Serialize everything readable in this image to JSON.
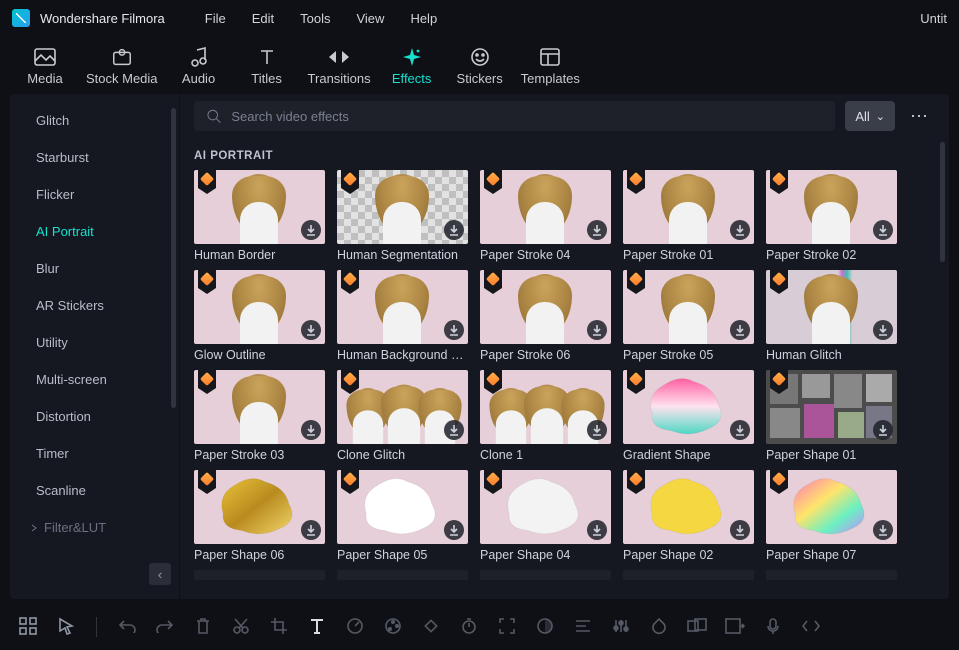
{
  "app": {
    "title": "Wondershare Filmora",
    "documentTitle": "Untit"
  },
  "menu": [
    "File",
    "Edit",
    "Tools",
    "View",
    "Help"
  ],
  "tool_tabs": [
    {
      "id": "media",
      "label": "Media",
      "icon": "image-icon"
    },
    {
      "id": "stockmedia",
      "label": "Stock Media",
      "icon": "cloud-image-icon"
    },
    {
      "id": "audio",
      "label": "Audio",
      "icon": "music-note-icon"
    },
    {
      "id": "titles",
      "label": "Titles",
      "icon": "text-icon"
    },
    {
      "id": "transitions",
      "label": "Transitions",
      "icon": "transition-icon"
    },
    {
      "id": "effects",
      "label": "Effects",
      "icon": "sparkle-icon",
      "active": true
    },
    {
      "id": "stickers",
      "label": "Stickers",
      "icon": "sticker-icon"
    },
    {
      "id": "templates",
      "label": "Templates",
      "icon": "template-icon"
    }
  ],
  "sidebar": {
    "items": [
      {
        "label": "Glitch"
      },
      {
        "label": "Starburst"
      },
      {
        "label": "Flicker"
      },
      {
        "label": "AI Portrait",
        "active": true
      },
      {
        "label": "Blur"
      },
      {
        "label": "AR Stickers"
      },
      {
        "label": "Utility"
      },
      {
        "label": "Multi-screen"
      },
      {
        "label": "Distortion"
      },
      {
        "label": "Timer"
      },
      {
        "label": "Scanline"
      }
    ],
    "footer_item": "Filter&LUT",
    "collapse_glyph": "‹"
  },
  "search": {
    "placeholder": "Search video effects",
    "filter_label": "All",
    "filter_chevron": "⌄"
  },
  "section_title": "AI PORTRAIT",
  "cards": [
    {
      "label": "Human Border",
      "thumbClass": "",
      "person": true
    },
    {
      "label": "Human Segmentation",
      "thumbClass": "checker",
      "person": true
    },
    {
      "label": "Paper Stroke 04",
      "thumbClass": "",
      "person": true
    },
    {
      "label": "Paper Stroke 01",
      "thumbClass": "",
      "person": true
    },
    {
      "label": "Paper Stroke 02",
      "thumbClass": "",
      "person": true
    },
    {
      "label": "Glow Outline",
      "thumbClass": "",
      "person": true
    },
    {
      "label": "Human Background Bl…",
      "thumbClass": "",
      "person": true
    },
    {
      "label": "Paper Stroke 06",
      "thumbClass": "",
      "person": true
    },
    {
      "label": "Paper Stroke 05",
      "thumbClass": "",
      "person": true
    },
    {
      "label": "Human Glitch",
      "thumbClass": "glitch",
      "person": true
    },
    {
      "label": "Paper Stroke 03",
      "thumbClass": "",
      "person": true
    },
    {
      "label": "Clone Glitch",
      "thumbClass": "",
      "person": "triple"
    },
    {
      "label": "Clone 1",
      "thumbClass": "",
      "person": "triple"
    },
    {
      "label": "Gradient Shape",
      "thumbClass": "gradient",
      "shape": "gradient"
    },
    {
      "label": "Paper Shape 01",
      "thumbClass": "collage",
      "shape": "none"
    },
    {
      "label": "Paper Shape 06",
      "thumbClass": "",
      "shape": "gold"
    },
    {
      "label": "Paper Shape 05",
      "thumbClass": "",
      "shape": "white"
    },
    {
      "label": "Paper Shape 04",
      "thumbClass": "",
      "shape": "crumple"
    },
    {
      "label": "Paper Shape 02",
      "thumbClass": "",
      "shape": "yellow"
    },
    {
      "label": "Paper Shape 07",
      "thumbClass": "",
      "shape": "rainbow"
    }
  ],
  "bottom_tools": [
    {
      "name": "grid-icon"
    },
    {
      "name": "pointer-icon"
    },
    {
      "name": "divider"
    },
    {
      "name": "undo-icon",
      "dim": true
    },
    {
      "name": "redo-icon",
      "dim": true
    },
    {
      "name": "trash-icon",
      "dim": true
    },
    {
      "name": "cut-icon",
      "dim": true
    },
    {
      "name": "crop-icon",
      "dim": true
    },
    {
      "name": "text-tool-icon",
      "strong": true
    },
    {
      "name": "speed-icon",
      "dim": true
    },
    {
      "name": "color-icon",
      "dim": true
    },
    {
      "name": "keyframe-icon",
      "dim": true
    },
    {
      "name": "timer-icon",
      "dim": true
    },
    {
      "name": "fit-icon",
      "dim": true
    },
    {
      "name": "mask-icon",
      "dim": true
    },
    {
      "name": "align-icon",
      "dim": true
    },
    {
      "name": "equalizer-icon",
      "dim": true
    },
    {
      "name": "chroma-icon",
      "dim": true
    },
    {
      "name": "group-icon",
      "dim": true
    },
    {
      "name": "export-frame-icon",
      "dim": true
    },
    {
      "name": "voiceover-icon",
      "dim": true
    },
    {
      "name": "code-icon",
      "dim": true
    }
  ],
  "icons": {
    "kebab": "⋯",
    "search": "search"
  },
  "colors": {
    "accent": "#16e0cf",
    "bg": "#0e1016",
    "panel": "#151820"
  }
}
